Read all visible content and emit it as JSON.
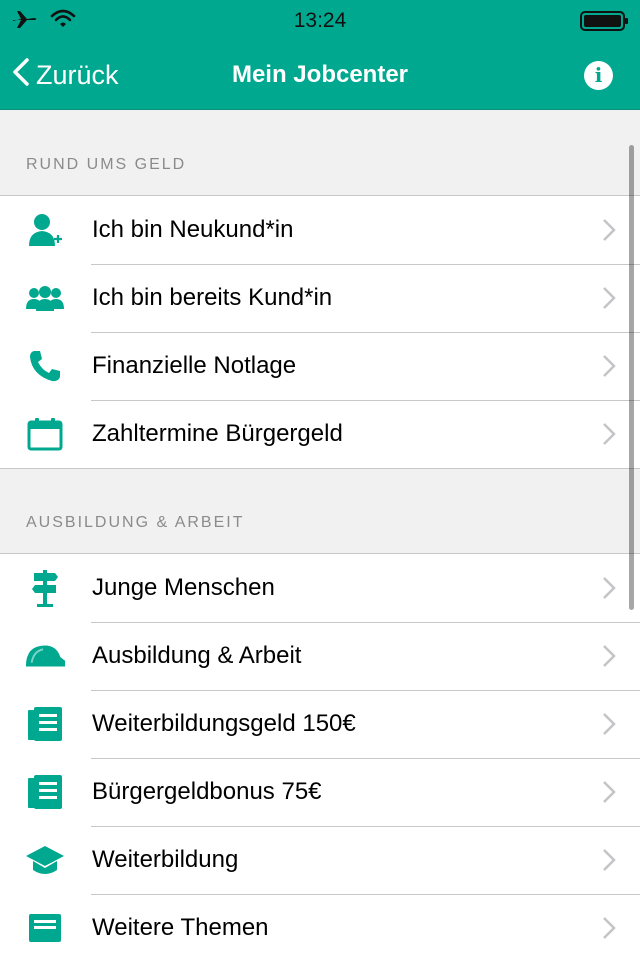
{
  "status_bar": {
    "time": "13:24"
  },
  "nav": {
    "back_label": "Zurück",
    "title": "Mein Jobcenter",
    "info_label": "i"
  },
  "colors": {
    "accent": "#00a88f",
    "separator": "#c8c7cc",
    "section_text": "#8b8b8b",
    "chevron": "#c4c4c8"
  },
  "sections": [
    {
      "header": "RUND UMS GELD",
      "items": [
        {
          "label": "Ich bin Neukund*in",
          "icon": "person-add-icon"
        },
        {
          "label": "Ich bin bereits Kund*in",
          "icon": "people-group-icon"
        },
        {
          "label": "Finanzielle Notlage",
          "icon": "phone-icon"
        },
        {
          "label": "Zahltermine Bürgergeld",
          "icon": "calendar-icon"
        }
      ]
    },
    {
      "header": "AUSBILDUNG & ARBEIT",
      "items": [
        {
          "label": "Junge Menschen",
          "icon": "signpost-icon"
        },
        {
          "label": "Ausbildung & Arbeit",
          "icon": "hard-hat-icon"
        },
        {
          "label": "Weiterbildungsgeld 150€",
          "icon": "document-list-icon"
        },
        {
          "label": "Bürgergeldbonus 75€",
          "icon": "document-list-icon"
        },
        {
          "label": "Weiterbildung",
          "icon": "graduation-cap-icon"
        },
        {
          "label": "Weitere Themen",
          "icon": "tray-icon"
        }
      ]
    }
  ]
}
